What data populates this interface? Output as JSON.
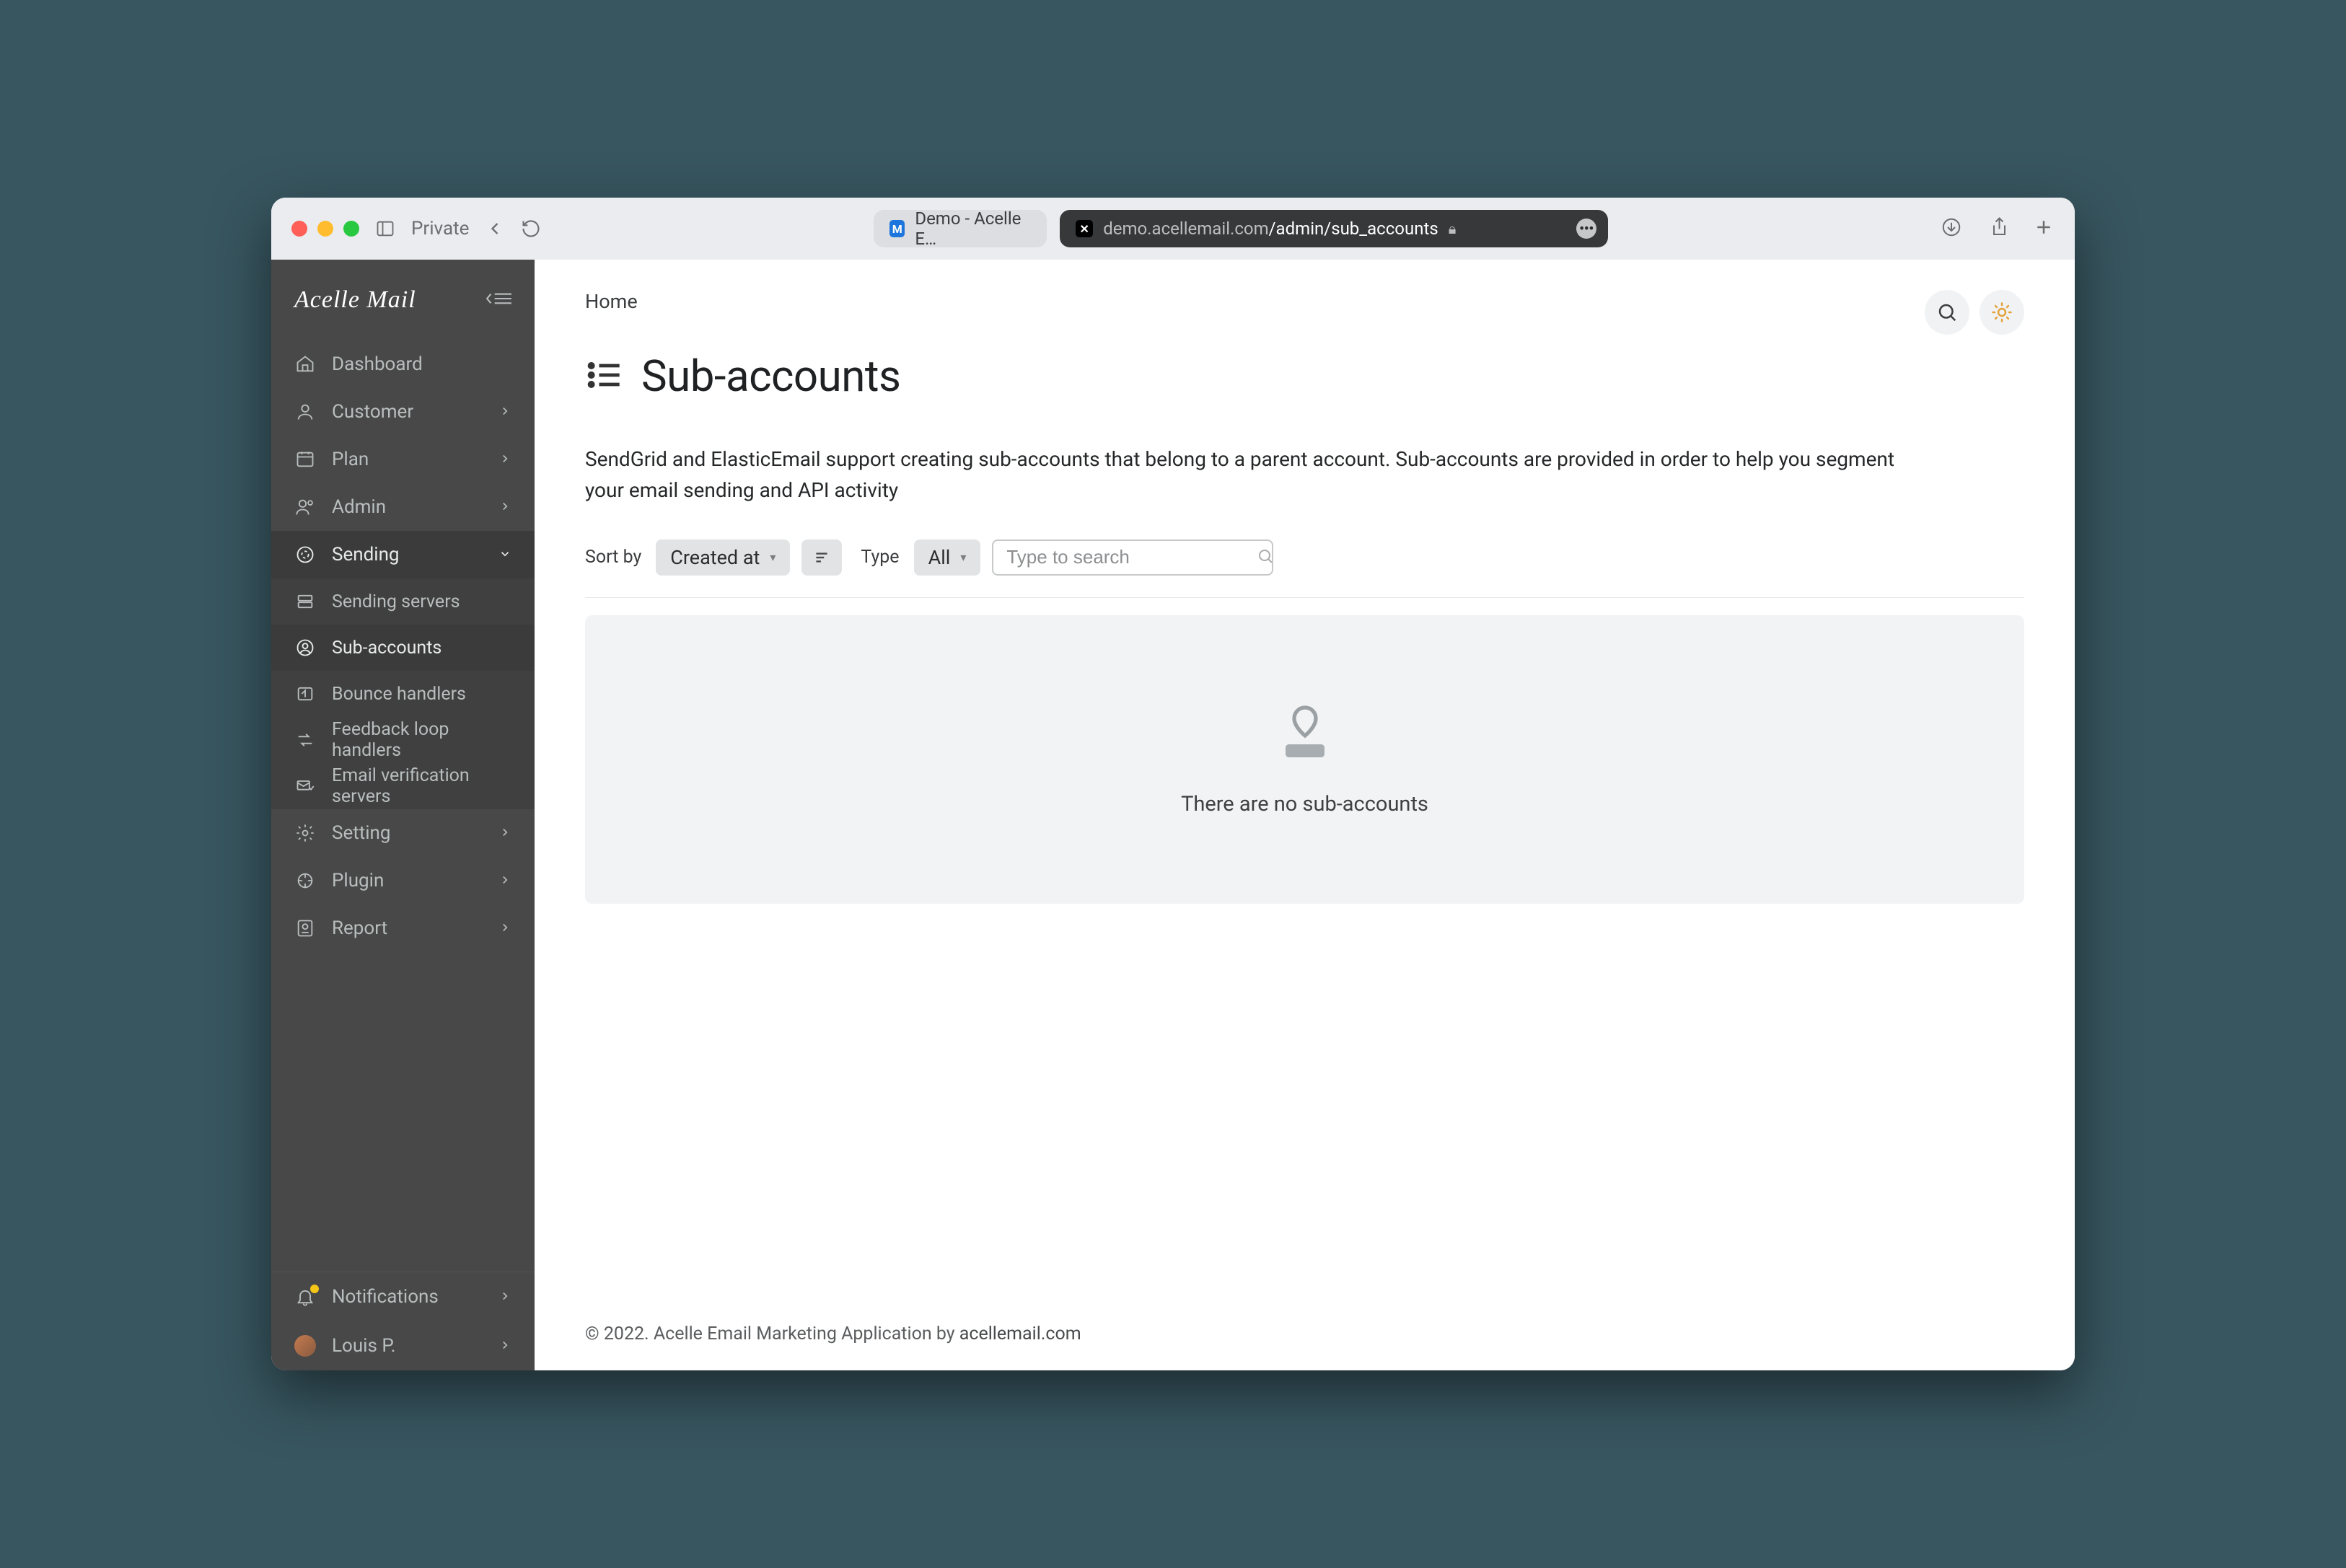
{
  "browser": {
    "private_label": "Private",
    "inactive_tab": "Demo - Acelle E…",
    "url_host": "demo.acellemail.com",
    "url_path": "/admin/sub_accounts"
  },
  "brand": {
    "name": "Acelle Mail"
  },
  "nav": {
    "dashboard": "Dashboard",
    "customer": "Customer",
    "plan": "Plan",
    "admin": "Admin",
    "sending": "Sending",
    "sending_sub": {
      "servers": "Sending servers",
      "sub_accounts": "Sub-accounts",
      "bounce": "Bounce handlers",
      "feedback": "Feedback loop handlers",
      "email_verify": "Email verification servers"
    },
    "setting": "Setting",
    "plugin": "Plugin",
    "report": "Report",
    "notifications": "Notifications",
    "user": "Louis P."
  },
  "page": {
    "breadcrumb": "Home",
    "title": "Sub-accounts",
    "description": "SendGrid and ElasticEmail support creating sub-accounts that belong to a parent account. Sub-accounts are provided in order to help you segment your email sending and API activity",
    "sort_label": "Sort by",
    "sort_value": "Created at",
    "type_label": "Type",
    "type_value": "All",
    "search_placeholder": "Type to search",
    "empty_message": "There are no sub-accounts"
  },
  "footer": {
    "copyright": "© 2022. Acelle Email Marketing Application by ",
    "link": "acellemail.com"
  }
}
